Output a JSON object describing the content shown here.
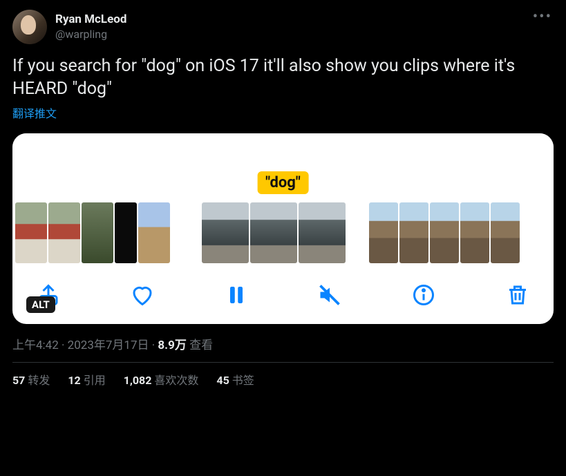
{
  "author": {
    "display_name": "Ryan McLeod",
    "handle": "@warpling"
  },
  "body_text": "If you search for \"dog\" on iOS 17 it'll also show you clips where it's HEARD \"dog\"",
  "translate_label": "翻译推文",
  "media": {
    "tag_text": "\"dog\"",
    "alt_badge": "ALT",
    "controls": {
      "share": "share-icon",
      "like": "heart-icon",
      "pause": "pause-icon",
      "mute": "mute-icon",
      "info": "info-icon",
      "delete": "trash-icon"
    }
  },
  "meta": {
    "time": "上午4:42",
    "separator": " · ",
    "date": "2023年7月17日",
    "views_num": "8.9万",
    "views_label": " 查看"
  },
  "stats": {
    "retweets_num": "57",
    "retweets_label": "转发",
    "quotes_num": "12",
    "quotes_label": "引用",
    "likes_num": "1,082",
    "likes_label": "喜欢次数",
    "bookmarks_num": "45",
    "bookmarks_label": "书签"
  }
}
